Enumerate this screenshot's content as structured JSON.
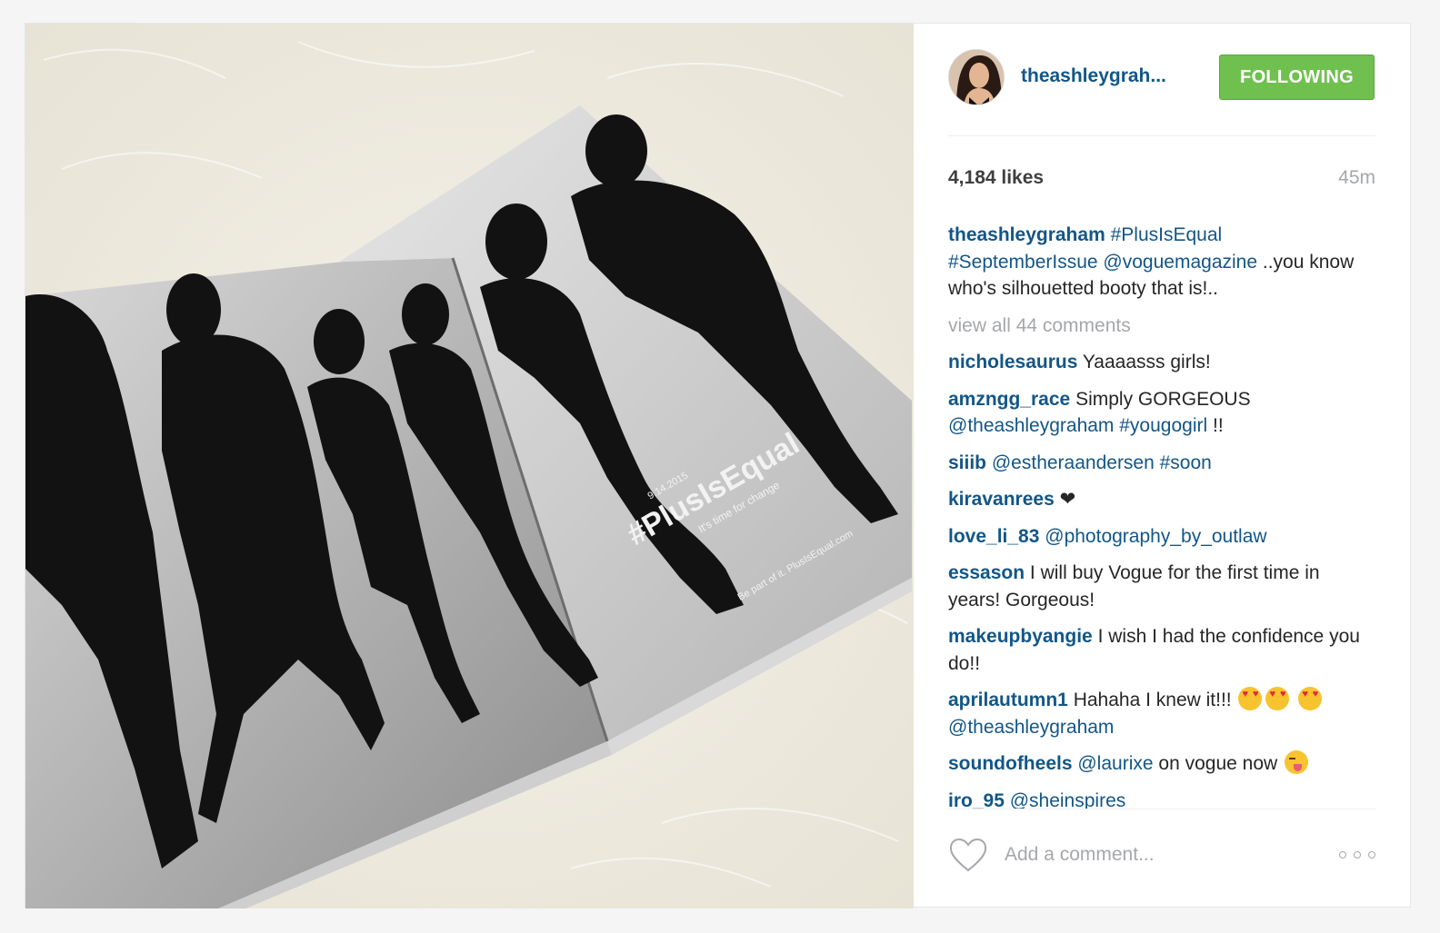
{
  "post": {
    "username": "theashleygrah...",
    "follow_label": "FOLLOWING",
    "likes": "4,184 likes",
    "time": "45m",
    "photo_text": {
      "date": "9.14.2015",
      "hashtag": "#PlusIsEqual",
      "tagline": "It's time for change",
      "cta": "Be part of it. PlusIsEqual.com"
    }
  },
  "caption": {
    "user": "theashleygraham",
    "tags": "#PlusIsEqual #SeptemberIssue @voguemagazine",
    "text": " ..you know who's silhouetted booty that is!.."
  },
  "view_all": "view all 44 comments",
  "comments": [
    {
      "user": "nicholesaurus",
      "text": "Yaaaasss girls!"
    },
    {
      "user": "amzngg_race",
      "text": "Simply GORGEOUS",
      "mention": "@theashleygraham #yougogirl",
      "tail": " !!"
    },
    {
      "user": "siiib",
      "mention": "@estheraandersen #soon"
    },
    {
      "user": "kiravanrees",
      "symbol": "❤"
    },
    {
      "user": "love_li_83",
      "mention": "@photography_by_outlaw"
    },
    {
      "user": "essason",
      "text": "I will buy Vogue for the first time in years! Gorgeous!"
    },
    {
      "user": "makeupbyangie",
      "text": "I wish I had the confidence you do!!"
    },
    {
      "user": "aprilautumn1",
      "text": "Hahaha I knew it!!!",
      "mention": "@theashleygraham"
    },
    {
      "user": "soundofheels",
      "mention": "@laurixe",
      "text": "on vogue now"
    },
    {
      "user": "iro_95",
      "mention": "@sheinspires"
    }
  ],
  "footer": {
    "comment_placeholder": "Add a comment..."
  },
  "icons": {
    "like": "heart-icon",
    "more": "more-options-icon",
    "emoji_love": "heart-eyes-emoji",
    "emoji_wink": "winking-tongue-emoji"
  },
  "colors": {
    "link": "#125688",
    "follow_button": "#70c050",
    "muted": "#a5a7aa"
  }
}
